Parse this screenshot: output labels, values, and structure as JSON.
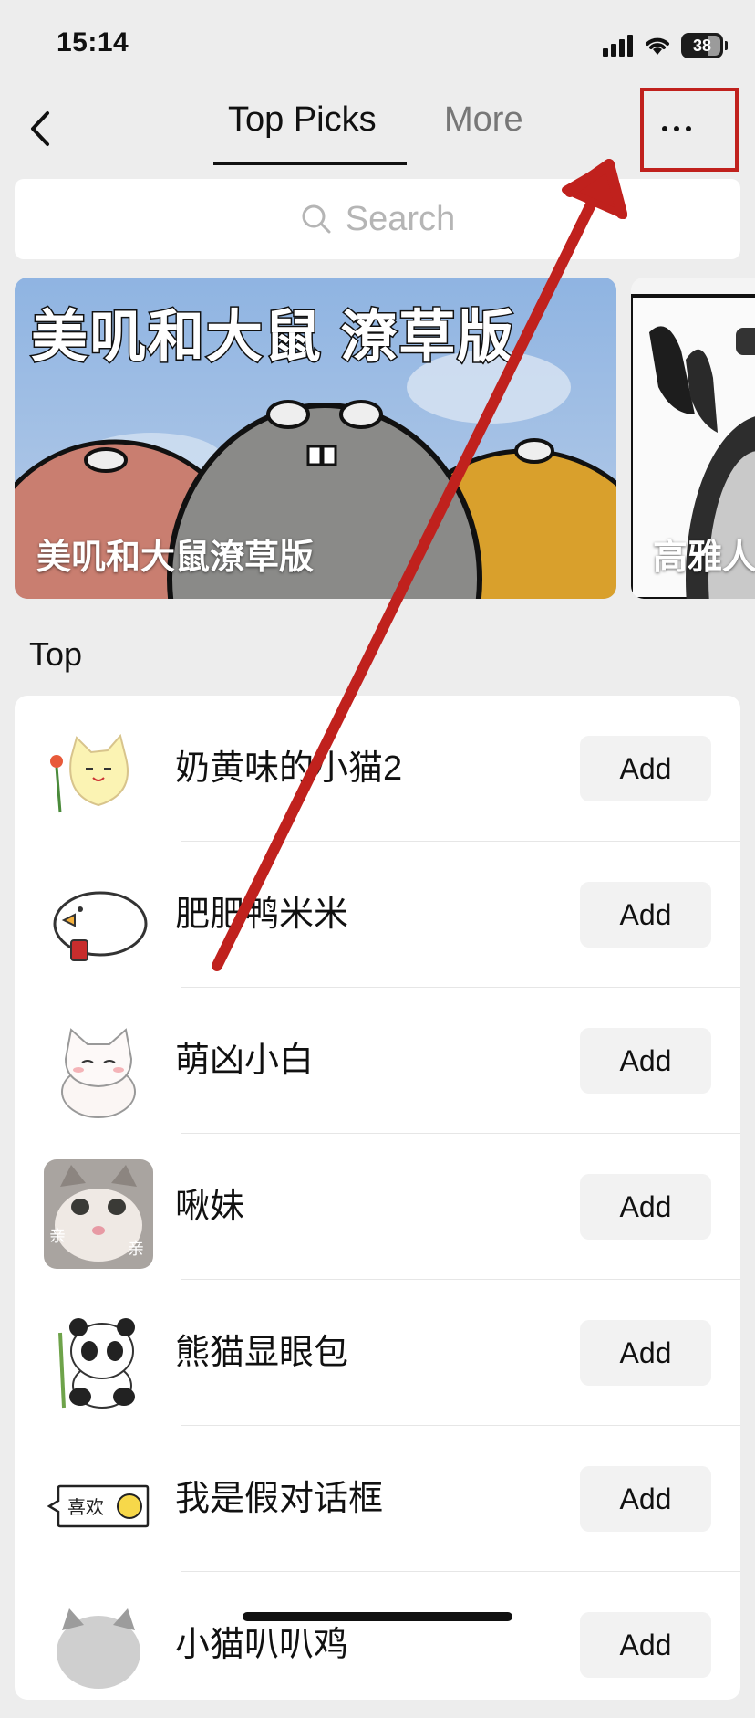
{
  "status_bar": {
    "time": "15:14",
    "battery": "38"
  },
  "nav": {
    "tabs": [
      {
        "label": "Top Picks",
        "active": true
      },
      {
        "label": "More",
        "active": false
      }
    ]
  },
  "search": {
    "placeholder": "Search"
  },
  "banners": [
    {
      "title_art": "美叽和大鼠 潦草版",
      "caption": "美叽和大鼠潦草版"
    },
    {
      "caption": "高雅人"
    }
  ],
  "section": {
    "title": "Top"
  },
  "sticker_packs": [
    {
      "name": "奶黄味的小猫2",
      "add_label": "Add",
      "icon": "yellow-cat-sticker"
    },
    {
      "name": "肥肥鸭米米",
      "add_label": "Add",
      "icon": "white-duck-sticker"
    },
    {
      "name": "萌凶小白",
      "add_label": "Add",
      "icon": "white-cat-sticker"
    },
    {
      "name": "啾妹",
      "add_label": "Add",
      "icon": "cat-photo-sticker",
      "thumb_text": [
        "亲",
        "亲"
      ]
    },
    {
      "name": "熊猫显眼包",
      "add_label": "Add",
      "icon": "panda-sticker"
    },
    {
      "name": "我是假对话框",
      "add_label": "Add",
      "icon": "speech-bubble-sticker",
      "thumb_text": [
        "喜欢"
      ]
    },
    {
      "name": "小猫叭叭鸡",
      "add_label": "Add",
      "icon": "cat-sticker"
    }
  ],
  "colors": {
    "annotation": "#c0211d",
    "background": "#ededed",
    "card": "#ffffff"
  }
}
